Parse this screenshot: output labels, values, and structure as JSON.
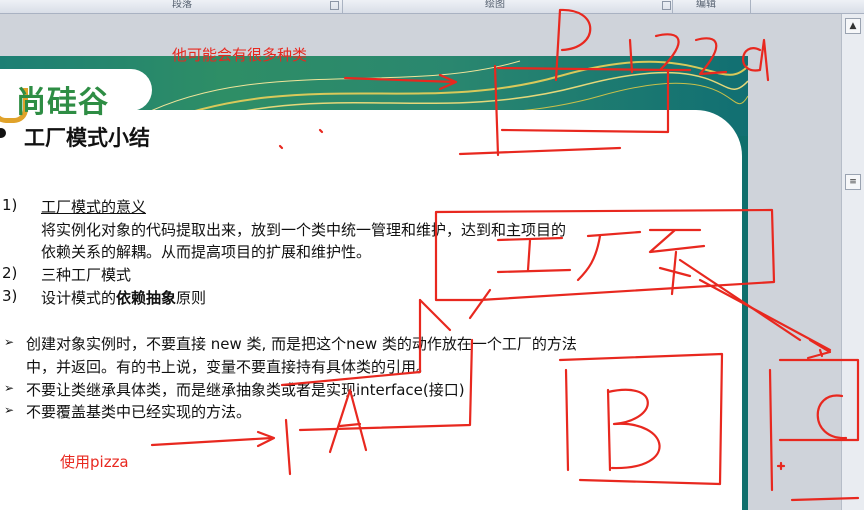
{
  "ribbon": {
    "groups": [
      "段落",
      "绘图",
      "编辑"
    ]
  },
  "slide": {
    "logo_text": "尚硅谷",
    "title": "工厂模式小结",
    "points": [
      {
        "num": "1)",
        "text": "工厂模式的意义"
      },
      {
        "num": "2)",
        "text": "三种工厂模式"
      },
      {
        "num": "3)",
        "text_before": "设计模式的",
        "bold": "依赖抽象",
        "text_after": "原则"
      }
    ],
    "meaning_lines": [
      "将实例化对象的代码提取出来，放到一个类中统一管理和维护，达到和主项目的",
      "依赖关系的解耦。从而提高项目的扩展和维护性。"
    ],
    "bullets": [
      "创建对象实例时，不要直接 new 类, 而是把这个new 类的动作放在一个工厂的方法",
      "中，并返回。有的书上说，变量不要直接持有具体类的引用。",
      "不要让类继承具体类，而是继承抽象类或者是实现interface(接口)",
      "不要覆盖基类中已经实现的方法。"
    ]
  },
  "annotations": {
    "top_note": "他可能会有很多种类",
    "bottom_note": "使用pizza"
  },
  "colors": {
    "ink": "#e8281f",
    "slide_teal": "#0f6f6c",
    "logo_green": "#2e8d44",
    "logo_orange": "#e0a22a"
  },
  "icons": [
    "bullet-arrow-icon",
    "scroll-up-icon",
    "scroll-split-icon"
  ]
}
